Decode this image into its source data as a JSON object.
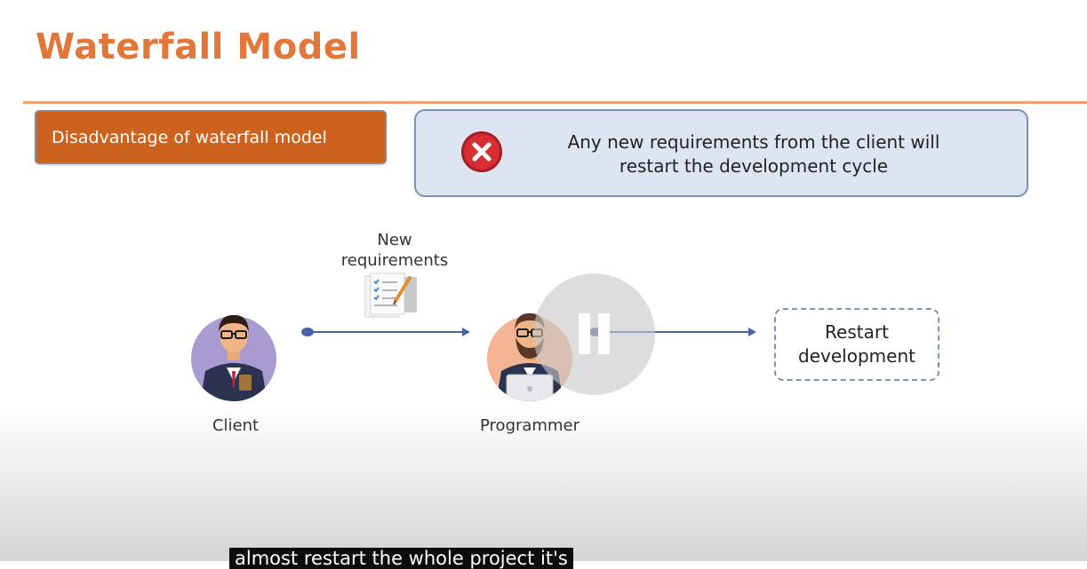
{
  "slide": {
    "title": "Waterfall Model",
    "tag_label": "Disadvantage of waterfall model",
    "callout": {
      "icon": "x-circle-icon",
      "line1": "Any new requirements from the client will",
      "line2": "restart the development cycle"
    }
  },
  "diagram": {
    "client_label": "Client",
    "programmer_label": "Programmer",
    "arrow_label_line1": "New",
    "arrow_label_line2": "requirements",
    "restart_line1": "Restart",
    "restart_line2": "development"
  },
  "player": {
    "control": "pause-icon",
    "caption": "almost restart the whole project it's"
  },
  "colors": {
    "title": "#e2773a",
    "tag_bg": "#cd621f",
    "callout_bg": "#dde5f3",
    "callout_border": "#7f8fb8",
    "arrow": "#4a63a8",
    "error_red": "#d72d35"
  }
}
